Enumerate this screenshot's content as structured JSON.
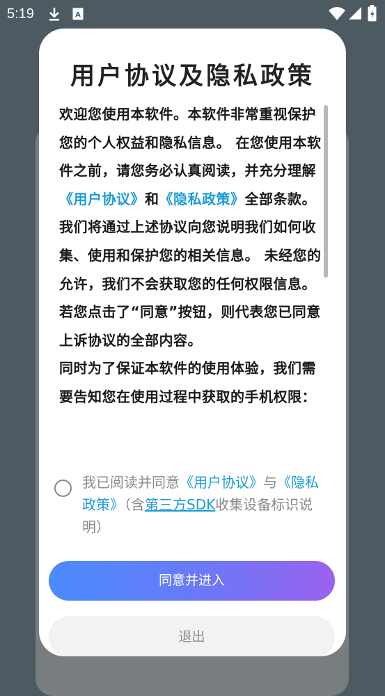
{
  "status_bar": {
    "time": "5:19",
    "icons": [
      "download-icon",
      "keyboard-a-icon",
      "wifi-icon",
      "cellular-signal-icon",
      "battery-icon"
    ]
  },
  "dialog": {
    "title": "用户协议及隐私政策",
    "body": {
      "p1_a": "欢迎您使用本软件。本软件非常重视保护您的个人权益和隐私信息。 在您使用本软件之前，请您务必认真阅读，并充分理解",
      "link_user_agreement": "《用户协议》",
      "p1_and": "和",
      "link_privacy_policy": "《隐私政策》",
      "p1_b": "全部条款。 我们将通过上述协议向您说明我们如何收集、使用和保护您的相关信息。 未经您的允许，我们不会获取您的任何权限信息。若您点击了“同意”按钮，则代表您已同意上诉协议的全部内容。",
      "p2": " 同时为了保证本软件的使用体验，我们需要告知您在使用过程中获取的手机权限："
    },
    "consent": {
      "prefix": "我已阅读并同意",
      "link_user_agreement": "《用户协议》",
      "and": "与",
      "link_privacy_policy": "《隐私政策》",
      "paren_open": "（含",
      "sdk_link": "第三方SDK",
      "suffix": "收集设备标识说明）",
      "checked": false
    },
    "agree_button": "同意并进入",
    "exit_button": "退出"
  },
  "colors": {
    "link": "#1c9bd8",
    "button_gradient_start": "#4a8cff",
    "button_gradient_end": "#9a62ee",
    "overlay": "#4e5a62"
  }
}
